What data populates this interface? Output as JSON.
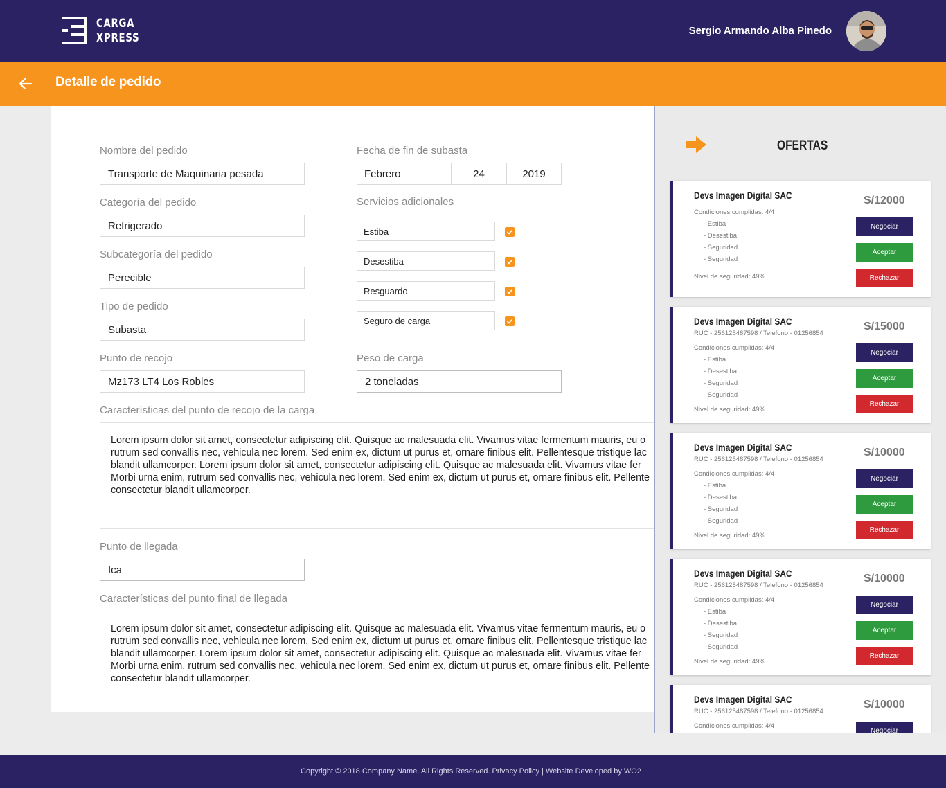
{
  "header": {
    "logo_line1": "CARGA",
    "logo_line2": "XPRESS",
    "user_name": "Sergio Armando Alba Pinedo"
  },
  "subheader": {
    "title": "Detalle de pedido"
  },
  "form": {
    "nombre": {
      "label": "Nombre del pedido",
      "value": "Transporte de Maquinaria pesada"
    },
    "categoria": {
      "label": "Categoría del pedido",
      "value": "Refrigerado"
    },
    "subcategoria": {
      "label": "Subcategoría del pedido",
      "value": "Perecible"
    },
    "tipo": {
      "label": "Tipo de pedido",
      "value": "Subasta"
    },
    "recojo": {
      "label": "Punto de recojo",
      "value": "Mz173 LT4 Los Robles"
    },
    "fecha": {
      "label": "Fecha de fin de subasta",
      "month": "Febrero",
      "day": "24",
      "year": "2019"
    },
    "servicios": {
      "label": "Servicios adicionales",
      "items": [
        {
          "name": "Estiba",
          "checked": true
        },
        {
          "name": "Desestiba",
          "checked": true
        },
        {
          "name": "Resguardo",
          "checked": true
        },
        {
          "name": "Seguro de carga",
          "checked": true
        }
      ]
    },
    "peso": {
      "label": "Peso de carga",
      "value": "2 toneladas"
    },
    "caract_recojo": {
      "label": "Características del punto de recojo de la carga",
      "lines": [
        "Lorem ipsum dolor sit amet, consectetur adipiscing elit. Quisque ac malesuada elit. Vivamus vitae fermentum mauris, eu o",
        "rutrum sed convallis nec, vehicula nec lorem. Sed enim ex, dictum ut purus et, ornare finibus elit. Pellentesque tristique lac",
        "blandit ullamcorper. Lorem ipsum dolor sit amet, consectetur adipiscing elit. Quisque ac malesuada elit. Vivamus vitae fer",
        "Morbi urna enim, rutrum sed convallis nec, vehicula nec lorem. Sed enim ex, dictum ut purus et, ornare finibus elit. Pellente",
        "consectetur blandit ullamcorper."
      ]
    },
    "llegada": {
      "label": "Punto de llegada",
      "value": "Ica"
    },
    "caract_llegada": {
      "label": "Características del punto final de llegada",
      "lines": [
        "Lorem ipsum dolor sit amet, consectetur adipiscing elit. Quisque ac malesuada elit. Vivamus vitae fermentum mauris, eu o",
        "rutrum sed convallis nec, vehicula nec lorem. Sed enim ex, dictum ut purus et, ornare finibus elit. Pellentesque tristique lac",
        "blandit ullamcorper. Lorem ipsum dolor sit amet, consectetur adipiscing elit. Quisque ac malesuada elit. Vivamus vitae fer",
        "Morbi urna enim, rutrum sed convallis nec, vehicula nec lorem. Sed enim ex, dictum ut purus et, ornare finibus elit. Pellente",
        "consectetur blandit ullamcorper."
      ]
    }
  },
  "ofertas": {
    "title": "OFERTAS",
    "labels": {
      "conditions": "Condiciones cumplidas: 4/4",
      "items": [
        "- Estiba",
        "- Desestiba",
        "- Seguridad",
        "- Seguridad"
      ],
      "security": "Nivel de seguridad: 49%",
      "negociar": "Negociar",
      "aceptar": "Aceptar",
      "rechazar": "Rechazar"
    },
    "offers": [
      {
        "company": "Devs Imagen Digital SAC",
        "ruc": "",
        "price": "S/12000"
      },
      {
        "company": "Devs Imagen Digital SAC",
        "ruc": "RUC - 256125487598   / Telefono - 01256854",
        "price": "S/15000"
      },
      {
        "company": "Devs Imagen Digital SAC",
        "ruc": "RUC - 256125487598   / Telefono - 01256854",
        "price": "S/10000"
      },
      {
        "company": "Devs Imagen Digital SAC",
        "ruc": "RUC - 256125487598   / Telefono - 01256854",
        "price": "S/10000"
      },
      {
        "company": "Devs Imagen Digital SAC",
        "ruc": "RUC - 256125487598   / Telefono - 01256854",
        "price": "S/10000"
      }
    ]
  },
  "footer": {
    "text": "Copyright © 2018 Company Name. All Rights Reserved. Privacy Policy   |   Website Developed by WO2"
  },
  "colors": {
    "primary": "#2a2262",
    "accent": "#f7941d",
    "accept": "#2e9b3e",
    "reject": "#d1292e"
  }
}
